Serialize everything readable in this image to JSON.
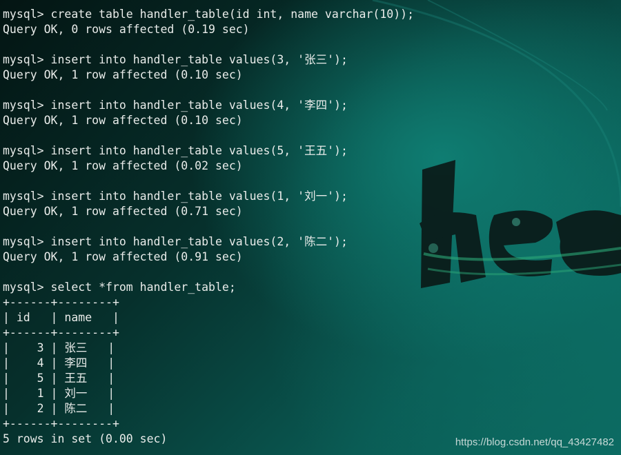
{
  "terminal": {
    "lines": [
      "mysql> create table handler_table(id int, name varchar(10));",
      "Query OK, 0 rows affected (0.19 sec)",
      "",
      "mysql> insert into handler_table values(3, '张三');",
      "Query OK, 1 row affected (0.10 sec)",
      "",
      "mysql> insert into handler_table values(4, '李四');",
      "Query OK, 1 row affected (0.10 sec)",
      "",
      "mysql> insert into handler_table values(5, '王五');",
      "Query OK, 1 row affected (0.02 sec)",
      "",
      "mysql> insert into handler_table values(1, '刘一');",
      "Query OK, 1 row affected (0.71 sec)",
      "",
      "mysql> insert into handler_table values(2, '陈二');",
      "Query OK, 1 row affected (0.91 sec)",
      "",
      "mysql> select *from handler_table;",
      "+------+--------+",
      "| id   | name   |",
      "+------+--------+",
      "|    3 | 张三   |",
      "|    4 | 李四   |",
      "|    5 | 王五   |",
      "|    1 | 刘一   |",
      "|    2 | 陈二   |",
      "+------+--------+",
      "5 rows in set (0.00 sec)"
    ]
  },
  "watermark": "https://blog.csdn.net/qq_43427482",
  "colors": {
    "text": "#e9ecea",
    "background": "#06302c",
    "accent": "#0f7d72"
  }
}
